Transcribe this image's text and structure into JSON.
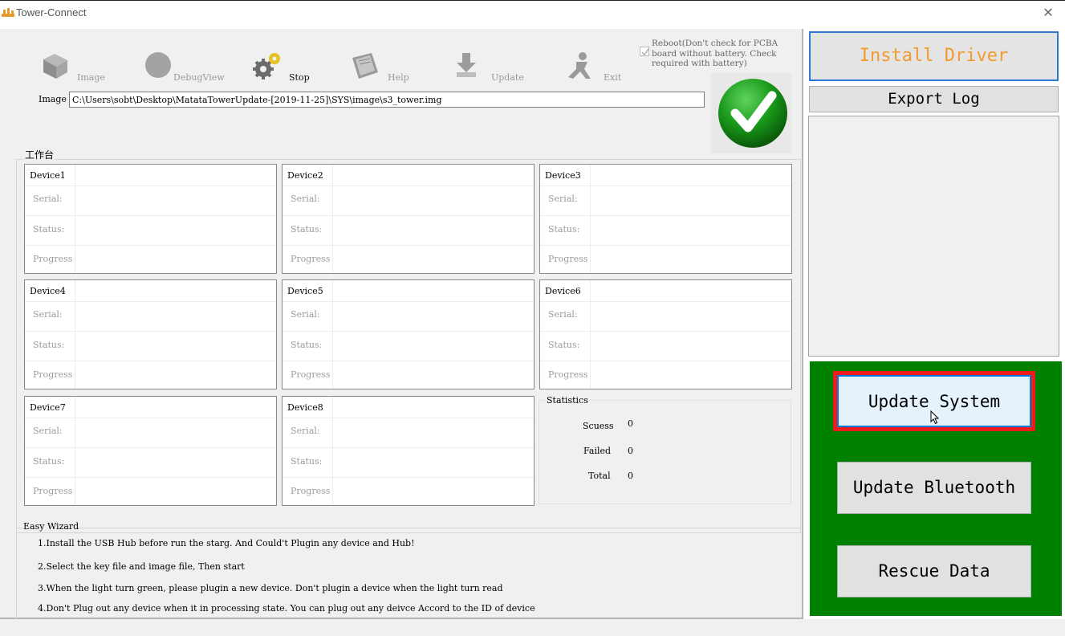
{
  "window": {
    "title": "Tower-Connect",
    "close_icon": "close-icon"
  },
  "toolbar": {
    "image": {
      "label": "Image",
      "icon": "cube-icon"
    },
    "debugview": {
      "label": "DebugView",
      "icon": "circle-icon"
    },
    "stop": {
      "label": "Stop",
      "icon": "gears-icon"
    },
    "help": {
      "label": "Help",
      "icon": "book-icon"
    },
    "update": {
      "label": "Update",
      "icon": "download-icon"
    },
    "exit": {
      "label": "Exit",
      "icon": "running-person-icon"
    }
  },
  "reboot": {
    "checked": true,
    "lines": [
      "Reboot(Don't check for PCBA",
      "board without battery. Check",
      "required with battery)"
    ]
  },
  "image_path": {
    "label": "Image",
    "value": "C:\\Users\\sobt\\Desktop\\MatataTowerUpdate-[2019-11-25]\\SYS\\image\\s3_tower.img"
  },
  "status_icon": "green-check-icon",
  "workbench": {
    "label": "工作台",
    "field_labels": {
      "serial": "Serial:",
      "status": "Status:",
      "progress": "Progress"
    },
    "devices": [
      {
        "name": "Device1"
      },
      {
        "name": "Device2"
      },
      {
        "name": "Device3"
      },
      {
        "name": "Device4"
      },
      {
        "name": "Device5"
      },
      {
        "name": "Device6"
      },
      {
        "name": "Device7"
      },
      {
        "name": "Device8"
      }
    ]
  },
  "statistics": {
    "label": "Statistics",
    "success": {
      "label": "Scuess",
      "value": "0"
    },
    "failed": {
      "label": "Failed",
      "value": "0"
    },
    "total": {
      "label": "Total",
      "value": "0"
    }
  },
  "wizard": {
    "label": "Easy Wizard",
    "steps": [
      "1.Install the USB Hub before run the starg. And Could't Plugin any device and Hub!",
      "2.Select the key file and image file, Then start",
      "3.When the light turn green, please plugin a new device. Don't plugin a device when the light turn read",
      "4.Don't Plug out any device when it in processing state. You can plug out any deivce Accord to the ID of device"
    ]
  },
  "side": {
    "install_driver": "Install Driver",
    "export_log": "Export Log",
    "update_system": "Update System",
    "update_bluetooth": "Update Bluetooth",
    "rescue_data": "Rescue Data"
  },
  "colors": {
    "accent_green": "#008000",
    "install_text": "#f39a2d",
    "highlight_red": "#ee1c1c",
    "focus_blue": "#0078d7"
  }
}
